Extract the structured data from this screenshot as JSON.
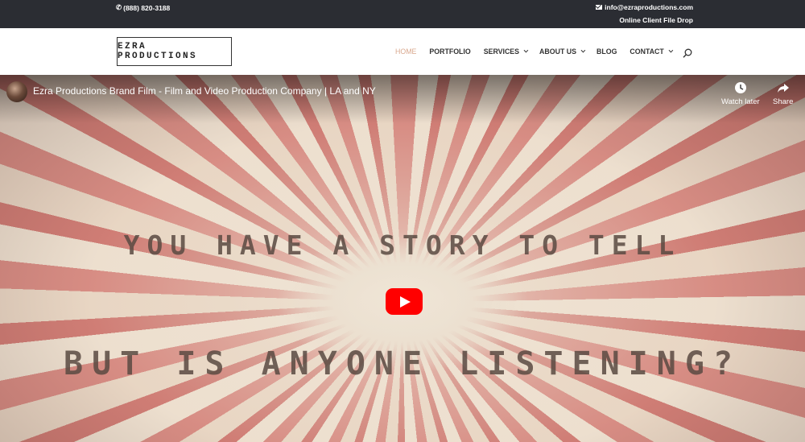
{
  "topbar": {
    "phone": "(888) 820-3188",
    "email": "info@ezraproductions.com",
    "file_drop": "Online Client File Drop"
  },
  "header": {
    "logo": "EZRA PRODUCTIONS",
    "nav": [
      {
        "label": "HOME",
        "active": true,
        "dropdown": false
      },
      {
        "label": "PORTFOLIO",
        "active": false,
        "dropdown": false
      },
      {
        "label": "SERVICES",
        "active": false,
        "dropdown": true
      },
      {
        "label": "ABOUT US",
        "active": false,
        "dropdown": true
      },
      {
        "label": "BLOG",
        "active": false,
        "dropdown": false
      },
      {
        "label": "CONTACT",
        "active": false,
        "dropdown": true
      }
    ]
  },
  "video": {
    "title": "Ezra Productions Brand Film - Film and Video Production Company | LA and NY",
    "watch_later": "Watch later",
    "share": "Share",
    "line1": "YOU HAVE A STORY TO TELL",
    "line2": "BUT IS ANYONE LISTENING?"
  },
  "colors": {
    "topbar_bg": "#2b2d33",
    "nav_active": "#d9a88e",
    "play_button": "#ff0000"
  }
}
